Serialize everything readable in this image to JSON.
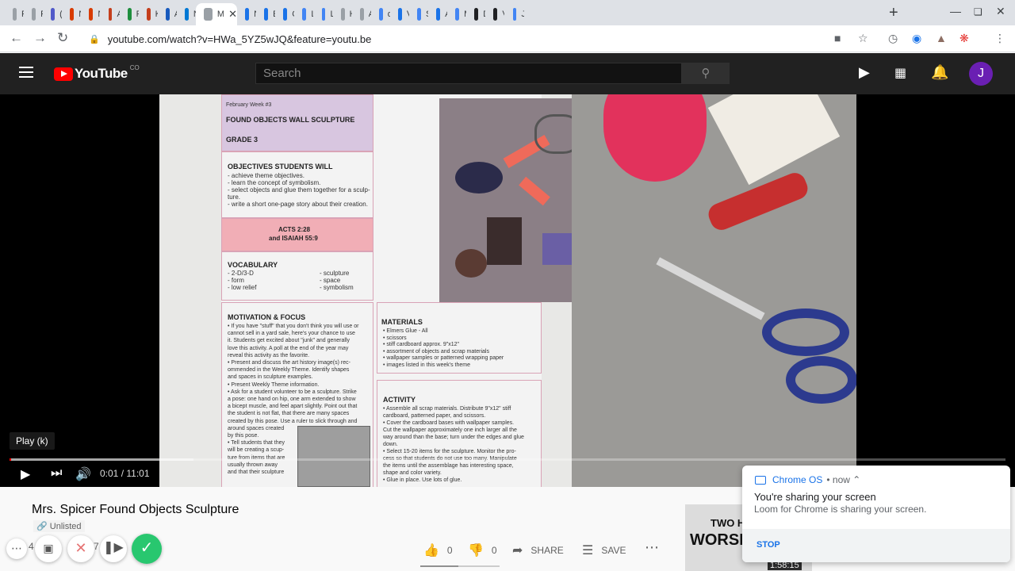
{
  "browser": {
    "tabs": [
      {
        "title": "R",
        "color": "#9aa0a6"
      },
      {
        "title": "R",
        "color": "#9aa0a6"
      },
      {
        "title": "(",
        "color": "#5059c9"
      },
      {
        "title": "N",
        "color": "#d83b01"
      },
      {
        "title": "N",
        "color": "#d83b01"
      },
      {
        "title": "A",
        "color": "#c43e1c"
      },
      {
        "title": "F",
        "color": "#1e8e3e"
      },
      {
        "title": "K",
        "color": "#c43e1c"
      },
      {
        "title": "A",
        "color": "#185abd"
      },
      {
        "title": "N",
        "color": "#0078d4"
      },
      {
        "title": "M",
        "color": "#9aa0a6",
        "active": true
      },
      {
        "title": "N",
        "color": "#1a73e8"
      },
      {
        "title": "E",
        "color": "#1a73e8"
      },
      {
        "title": "C",
        "color": "#1a73e8"
      },
      {
        "title": "L",
        "color": "#4285f4"
      },
      {
        "title": "L",
        "color": "#4285f4"
      },
      {
        "title": "H",
        "color": "#9aa0a6"
      },
      {
        "title": "A",
        "color": "#9aa0a6"
      },
      {
        "title": "d",
        "color": "#4285f4"
      },
      {
        "title": "V",
        "color": "#1a73e8"
      },
      {
        "title": "S",
        "color": "#4285f4"
      },
      {
        "title": "A",
        "color": "#1a73e8"
      },
      {
        "title": "M",
        "color": "#4285f4"
      },
      {
        "title": "D",
        "color": "#202124"
      },
      {
        "title": "V",
        "color": "#202124"
      },
      {
        "title": "J",
        "color": "#4285f4"
      }
    ],
    "url": "youtube.com/watch?v=HWa_5YZ5wJQ&feature=youtu.be"
  },
  "youtube": {
    "logo_text": "YouTube",
    "country_code": "CO",
    "search_placeholder": "Search",
    "avatar_letter": "J"
  },
  "player": {
    "tooltip": "Play (k)",
    "current_time": "0:01",
    "duration": "11:01",
    "time_display": "0:01 / 11:01",
    "played_fraction": 0.0015,
    "buffered_fraction": 0.185
  },
  "document": {
    "week": "February Week #3",
    "title": "FOUND OBJECTS WALL SCULPTURE",
    "grade": "GRADE 3",
    "objectives_heading": "OBJECTIVES  STUDENTS WILL",
    "objectives": [
      "- achieve theme objectives.",
      "- learn the concept of symbolism.",
      "- select objects and glue them together for a sculp-",
      "  ture.",
      "- write a short one-page story about their creation."
    ],
    "scripture": [
      "ACTS 2:28",
      "and ISAIAH 55:9"
    ],
    "vocabulary_heading": "VOCABULARY",
    "vocabulary_left": [
      "- 2-D/3-D",
      "- form",
      "- low relief"
    ],
    "vocabulary_right": [
      "- sculpture",
      "- space",
      "- symbolism"
    ],
    "motivation_heading": "MOTIVATION & FOCUS",
    "motivation": [
      "• If you have \"stuff\" that you don't  think you will use or",
      "cannot sell in a yard sale, here's your chance to use",
      "it.  Students get excited about \"junk\" and generally",
      "love this activity.  A poll at the end of the year may",
      "reveal this activity as the favorite.",
      "• Present and discuss the art history image(s) rec-",
      "ommended in the Weekly Theme.  Identify shapes",
      "and spaces in sculpture examples.",
      "• Present Weekly Theme information.",
      "• Ask for a student volunteer to be a sculpture.  Strike",
      "a pose: one hand on hip, one arm extended to show",
      "a bicept muscle, and feel apart slightly.  Point out that",
      "the student is not flat, that there are many spaces",
      "created by this pose.  Use a ruler to slick through and",
      "around spaces created",
      "by this pose.",
      "• Tell students that they",
      "will be creating a scup-",
      "ture from items that are",
      "usually thrown away",
      "and that their sculpture"
    ],
    "materials_heading": "MATERIALS",
    "materials": [
      "• Elmers Glue - All",
      "• scissors",
      "• stiff cardboard approx. 9\"x12\"",
      "• assortment of objects and scrap materials",
      "• wallpaper samples or patterned wrapping paper",
      "• images listed in this week's theme"
    ],
    "activity_heading": "ACTIVITY",
    "activity": [
      "• Assemble all scrap materials.  Distribute 9\"x12\" stiff",
      "cardboard, patterned paper, and scissors.",
      "• Cover the cardboard bases with wallpaper samples.",
      "Cut the wallpaper approximately one inch larger all the",
      "way around than the base; turn under the edges and glue",
      "down.",
      "• Select 15-20 items for the sculpture.  Monitor the pro-",
      "cess so that students do not use too many.  Manipulate",
      "the items until the assemblage has interesting space,",
      "shape and color variety.",
      "• Glue in place.  Use lots of glue."
    ]
  },
  "video_info": {
    "title": "Mrs. Spicer Found Objects Sculpture",
    "visibility": "Unlisted",
    "views_partial": "7",
    "likes": "0",
    "dislikes": "0",
    "share_label": "SHARE",
    "save_label": "SAVE",
    "like_ratio": 0.48
  },
  "recommended": {
    "thumb_line1": "TWO H",
    "thumb_line2": "WORSH",
    "duration": "1:58:15"
  },
  "notification": {
    "app": "Chrome OS",
    "time": "now",
    "title": "You're sharing your screen",
    "body": "Loom for Chrome is sharing your screen.",
    "action": "STOP"
  },
  "loom": {
    "count_prefix": "4"
  }
}
